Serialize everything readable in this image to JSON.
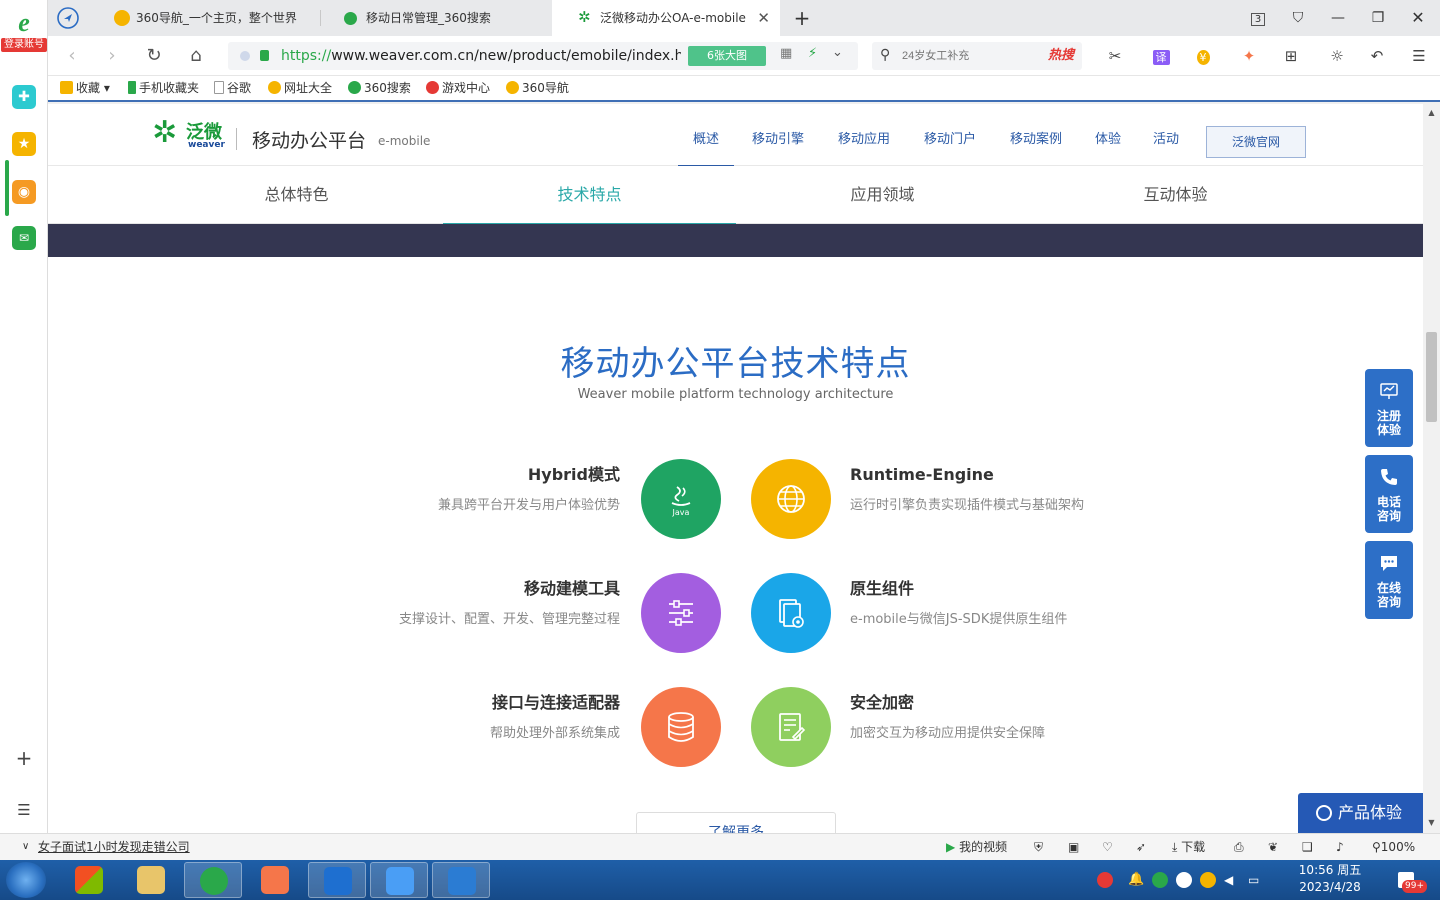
{
  "sidebar": {
    "logo_letter": "e",
    "login_label": "登录账号",
    "add_label": "+",
    "list_label": "☰"
  },
  "tabs": [
    {
      "label": "360导航_一个主页，整个世界"
    },
    {
      "label": "移动日常管理_360搜索"
    },
    {
      "label": "泛微移动办公OA-e-mobile"
    }
  ],
  "window": {
    "tab_count": "3"
  },
  "address": {
    "protocol": "https://",
    "url": "www.weaver.com.cn/new/product/emobile/index.ht",
    "big_pic": "6张大图"
  },
  "search": {
    "placeholder": "24岁女工补充",
    "hot_label": "热搜"
  },
  "bookmarks": [
    {
      "label": "收藏"
    },
    {
      "label": "手机收藏夹"
    },
    {
      "label": "谷歌"
    },
    {
      "label": "网址大全"
    },
    {
      "label": "360搜索"
    },
    {
      "label": "游戏中心"
    },
    {
      "label": "360导航"
    }
  ],
  "site": {
    "brand_cn": "泛微",
    "brand_en": "weaver",
    "platform": "移动办公平台",
    "platform_en": "e-mobile",
    "nav": [
      "概述",
      "移动引擎",
      "移动应用",
      "移动门户",
      "移动案例",
      "体验",
      "活动"
    ],
    "official": "泛微官网",
    "subtabs": [
      "总体特色",
      "技术特点",
      "应用领域",
      "互动体验"
    ]
  },
  "section": {
    "title": "移动办公平台技术特点",
    "subtitle": "Weaver mobile platform technology architecture",
    "features": [
      {
        "title": "Hybrid模式",
        "desc": "兼具跨平台开发与用户体验优势",
        "icon": "java-icon",
        "color": "#1fa463"
      },
      {
        "title": "Runtime-Engine",
        "desc": "运行时引擎负责实现插件模式与基础架构",
        "icon": "globe-icon",
        "color": "#f5b400"
      },
      {
        "title": "移动建模工具",
        "desc": "支撑设计、配置、开发、管理完整过程",
        "icon": "sliders-icon",
        "color": "#a35ee0"
      },
      {
        "title": "原生组件",
        "desc": "e-mobile与微信JS-SDK提供原生组件",
        "icon": "component-icon",
        "color": "#1aa6e8"
      },
      {
        "title": "接口与连接适配器",
        "desc": "帮助处理外部系统集成",
        "icon": "database-icon",
        "color": "#f5764a"
      },
      {
        "title": "安全加密",
        "desc": "加密交互为移动应用提供安全保障",
        "icon": "document-lock-icon",
        "color": "#8fcf5f"
      }
    ],
    "more_label": "了解更多"
  },
  "float": {
    "register": "注册体验",
    "phone": "电话咨询",
    "online": "在线咨询",
    "product": "产品体验"
  },
  "status": {
    "news": "女子面试1小时发现走错公司",
    "video": "我的视频",
    "download": "下载",
    "zoom": "100%"
  },
  "taskbar": {
    "time": "10:56 周五",
    "date": "2023/4/28",
    "badge": "99+"
  }
}
